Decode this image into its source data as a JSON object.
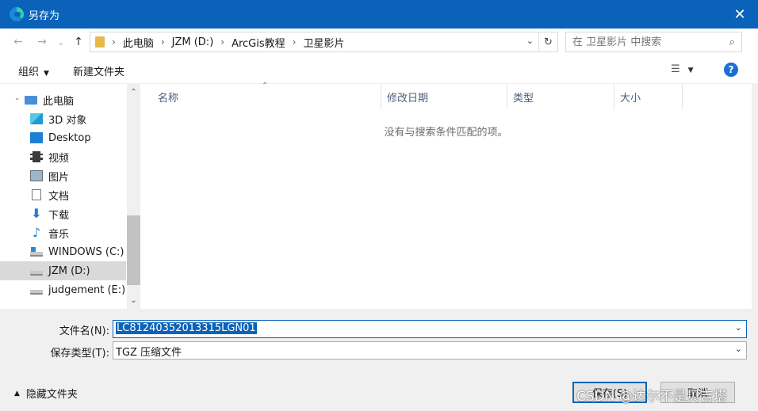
{
  "window": {
    "title": "另存为",
    "close_glyph": "✕"
  },
  "nav": {
    "back_glyph": "←",
    "forward_glyph": "→",
    "recent_glyph": "⌄",
    "up_glyph": "↑",
    "breadcrumbs": [
      "此电脑",
      "JZM (D:)",
      "ArcGis教程",
      "卫星影片"
    ],
    "crumb_sep": "›",
    "dropdown_glyph": "⌄",
    "refresh_glyph": "↻",
    "search_placeholder": "在 卫星影片 中搜索",
    "search_glyph": "⌕"
  },
  "toolbar": {
    "organize_label": "组织",
    "new_folder_label": "新建文件夹",
    "caret_glyph": "▼",
    "view_glyph": "☰",
    "help_glyph": "?"
  },
  "tree": {
    "up_glyph": "⌃",
    "down_glyph": "⌄",
    "expand_glyph": "›",
    "items": [
      {
        "label": "此电脑",
        "icon": "computer-icon"
      },
      {
        "label": "3D 对象",
        "icon": "3d-objects-icon"
      },
      {
        "label": "Desktop",
        "icon": "desktop-icon"
      },
      {
        "label": "视频",
        "icon": "video-icon"
      },
      {
        "label": "图片",
        "icon": "pictures-icon"
      },
      {
        "label": "文档",
        "icon": "documents-icon"
      },
      {
        "label": "下载",
        "icon": "download-icon"
      },
      {
        "label": "音乐",
        "icon": "music-icon"
      },
      {
        "label": "WINDOWS (C:)",
        "icon": "windows-drive-icon"
      },
      {
        "label": "JZM (D:)",
        "icon": "drive-icon",
        "selected": true
      },
      {
        "label": "judgement (E:)",
        "icon": "drive-icon"
      }
    ],
    "download_glyph": "⬇",
    "music_glyph": "♪"
  },
  "filelist": {
    "columns": [
      "名称",
      "修改日期",
      "类型",
      "大小"
    ],
    "sort_glyph": "⌃",
    "empty_message": "没有与搜索条件匹配的项。"
  },
  "form": {
    "filename_label": "文件名(N):",
    "filename_value": "LC81240352013315LGN01",
    "filetype_label": "保存类型(T):",
    "filetype_value": "TGZ 压缩文件",
    "dropdown_glyph": "⌄"
  },
  "footer": {
    "hide_folders_label": "隐藏文件夹",
    "hide_caret_glyph": "▲",
    "save_label": "保存(S)",
    "cancel_label": "取消",
    "watermark": "CSDN @达尔不是贝吉塔"
  }
}
